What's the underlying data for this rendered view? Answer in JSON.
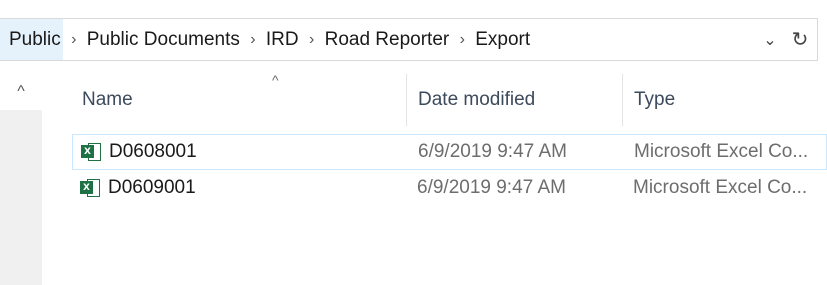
{
  "address_bar": {
    "breadcrumbs": [
      "Public",
      "Public Documents",
      "IRD",
      "Road Reporter",
      "Export"
    ],
    "separator": "›",
    "dropdown_glyph": "⌄",
    "refresh_glyph": "↻"
  },
  "columns": {
    "name": "Name",
    "date_modified": "Date modified",
    "type": "Type",
    "sort_glyph": "^"
  },
  "files": [
    {
      "name": "D0608001",
      "date_modified": "6/9/2019 9:47 AM",
      "type": "Microsoft Excel Co...",
      "icon": "excel-file-icon"
    },
    {
      "name": "D0609001",
      "date_modified": "6/9/2019 9:47 AM",
      "type": "Microsoft Excel Co...",
      "icon": "excel-file-icon"
    }
  ],
  "nav_pane": {
    "collapse_glyph": "^"
  },
  "colors": {
    "accent": "#e5f1fb",
    "selection_border": "#cce8ff",
    "excel_green": "#1e7145"
  }
}
